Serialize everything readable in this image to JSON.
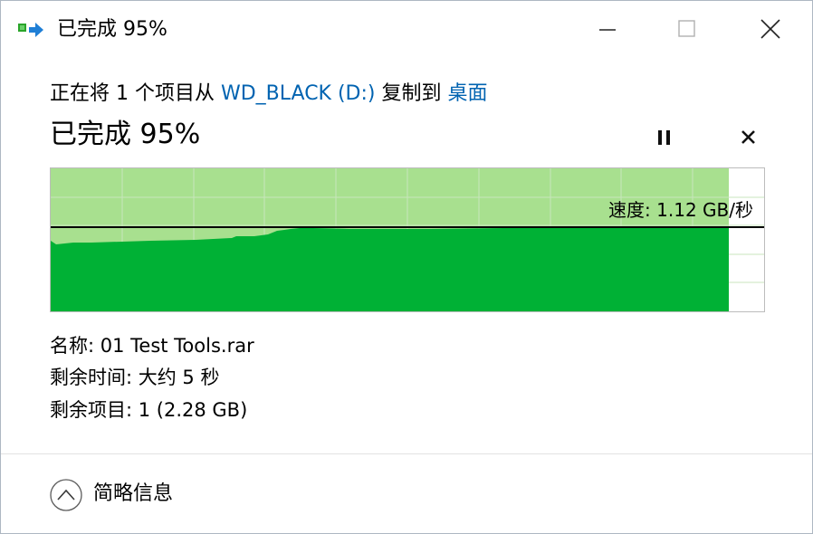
{
  "window": {
    "title": "已完成 95%",
    "controls": {
      "minimize": "minimize",
      "maximize": "maximize",
      "close": "close"
    }
  },
  "copy_status": {
    "prefix": "正在将 1 个项目从 ",
    "source": "WD_BLACK (D:)",
    "middle": " 复制到 ",
    "destination": "桌面",
    "percent_text": "已完成 95%",
    "progress_fraction": 0.95
  },
  "graph": {
    "speed_text": "速度: 1.12 GB/秒",
    "colors": {
      "completed_area": "#a8e08f",
      "speed_fill": "#00b135",
      "grid": "#c8e6bc",
      "speed_line": "#000000"
    }
  },
  "details": {
    "name_text": "名称: 01 Test Tools.rar",
    "time_remaining_text": "剩余时间: 大约 5 秒",
    "items_remaining_text": "剩余项目: 1 (2.28 GB)"
  },
  "footer": {
    "toggle_label": "简略信息",
    "toggle_icon": "chevron-up-icon"
  }
}
